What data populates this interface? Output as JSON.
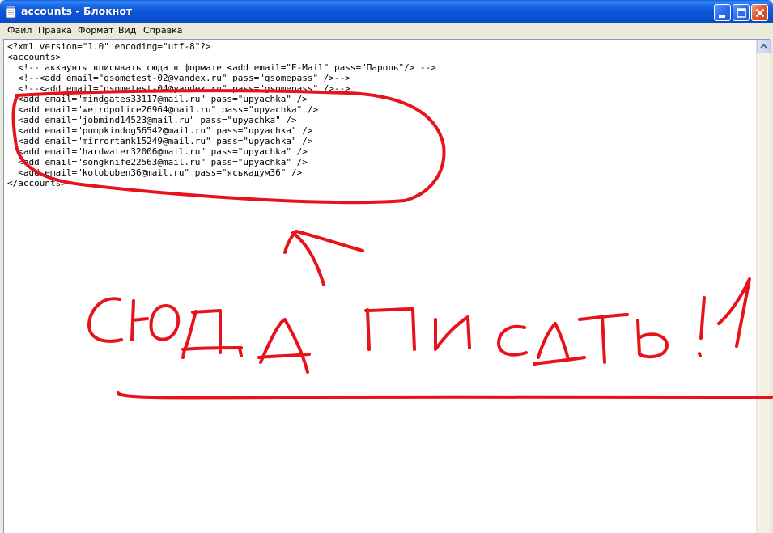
{
  "window": {
    "title": "accounts - Блокнот"
  },
  "menu": [
    {
      "label": "Файл"
    },
    {
      "label": "Правка"
    },
    {
      "label": "Формат"
    },
    {
      "label": "Вид"
    },
    {
      "label": "Справка"
    }
  ],
  "document": {
    "lines": [
      "<?xml version=\"1.0\" encoding=\"utf-8\"?>",
      "<accounts>",
      "  <!-- аккаунты вписывать сюда в формате <add email=\"E-Mail\" pass=\"Пароль\"/> -->",
      "  <!--<add email=\"gsometest-02@yandex.ru\" pass=\"gsomepass\" />-->",
      "  <!--<add email=\"gsometest-04@yandex.ru\" pass=\"gsomepass\" />-->",
      "  <add email=\"mindgates33117@mail.ru\" pass=\"upyachka\" />",
      "  <add email=\"weirdpolice26964@mail.ru\" pass=\"upyachka\" />",
      "  <add email=\"jobmind14523@mail.ru\" pass=\"upyachka\" />",
      "  <add email=\"pumpkindog56542@mail.ru\" pass=\"upyachka\" />",
      "  <add email=\"mirrortank15249@mail.ru\" pass=\"upyachka\" />",
      "  <add email=\"hardwater32006@mail.ru\" pass=\"upyachka\" />",
      "  <add email=\"songknife22563@mail.ru\" pass=\"upyachka\" />",
      "  <add email=\"kotobuben36@mail.ru\" pass=\"яськадум36\" />",
      "</accounts>"
    ]
  },
  "annotation": {
    "handwritten_text": "СЮДА ПИСАТЬ!1",
    "color": "#e8121b"
  },
  "colors": {
    "titlebar": "#0a55d9",
    "menubar": "#ece9d8",
    "editor_bg": "#ffffff",
    "annotation": "#e8121b"
  },
  "icons": {
    "window": "notepad-icon",
    "minimize": "minimize-icon",
    "maximize": "maximize-icon",
    "close": "close-icon"
  }
}
